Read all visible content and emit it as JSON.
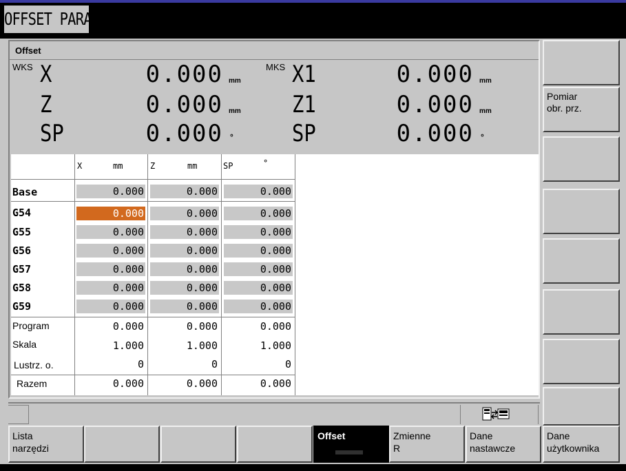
{
  "window": {
    "title": "OFFSET PARAM"
  },
  "panel": {
    "title": "Offset"
  },
  "positions": {
    "wks_label": "WKS",
    "mks_label": "MKS",
    "rows": [
      {
        "wks_axis": "X",
        "wks_value": "0.000",
        "wks_unit": "mm",
        "mks_axis": "X1",
        "mks_value": "0.000",
        "mks_unit": "mm"
      },
      {
        "wks_axis": "Z",
        "wks_value": "0.000",
        "wks_unit": "mm",
        "mks_axis": "Z1",
        "mks_value": "0.000",
        "mks_unit": "mm"
      },
      {
        "wks_axis": "SP",
        "wks_value": "0.000",
        "wks_unit": "°",
        "mks_axis": "SP",
        "mks_value": "0.000",
        "mks_unit": "°"
      }
    ]
  },
  "table": {
    "columns": [
      {
        "axis": "X",
        "unit": "mm"
      },
      {
        "axis": "Z",
        "unit": "mm"
      },
      {
        "axis": "SP",
        "unit": "°"
      }
    ],
    "rows": [
      {
        "label": "Base",
        "values": [
          "0.000",
          "0.000",
          "0.000"
        ]
      },
      {
        "label": "G54",
        "values": [
          "0.000",
          "0.000",
          "0.000"
        ]
      },
      {
        "label": "G55",
        "values": [
          "0.000",
          "0.000",
          "0.000"
        ]
      },
      {
        "label": "G56",
        "values": [
          "0.000",
          "0.000",
          "0.000"
        ]
      },
      {
        "label": "G57",
        "values": [
          "0.000",
          "0.000",
          "0.000"
        ]
      },
      {
        "label": "G58",
        "values": [
          "0.000",
          "0.000",
          "0.000"
        ]
      },
      {
        "label": "G59",
        "values": [
          "0.000",
          "0.000",
          "0.000"
        ]
      },
      {
        "label": "Program",
        "values": [
          "0.000",
          "0.000",
          "0.000"
        ]
      },
      {
        "label": "Skala",
        "values": [
          "1.000",
          "1.000",
          "1.000"
        ]
      },
      {
        "label": "Lustrz. o.",
        "values": [
          "0",
          "0",
          "0"
        ]
      },
      {
        "label": "Razem",
        "values": [
          "0.000",
          "0.000",
          "0.000"
        ]
      }
    ]
  },
  "status": {
    "icon": "channel-switch-icon"
  },
  "vertical_softkeys": [
    {
      "line1": "",
      "line2": ""
    },
    {
      "line1": "Pomiar",
      "line2": "obr. prz."
    },
    {
      "line1": "",
      "line2": ""
    },
    {
      "line1": "",
      "line2": ""
    },
    {
      "line1": "",
      "line2": ""
    },
    {
      "line1": "",
      "line2": ""
    },
    {
      "line1": "",
      "line2": ""
    },
    {
      "line1": "",
      "line2": ""
    }
  ],
  "horizontal_softkeys": [
    {
      "line1": "Lista",
      "line2": "narzędzi"
    },
    {
      "line1": "",
      "line2": ""
    },
    {
      "line1": "",
      "line2": ""
    },
    {
      "line1": "",
      "line2": ""
    },
    {
      "line1": "Offset",
      "line2": ""
    },
    {
      "line1": "Zmienne",
      "line2": "R"
    },
    {
      "line1": "Dane",
      "line2": "nastawcze"
    },
    {
      "line1": "Dane",
      "line2": "użytkownika"
    }
  ],
  "colors": {
    "active_cell": "#d2691e",
    "background": "#c6c6c6"
  }
}
